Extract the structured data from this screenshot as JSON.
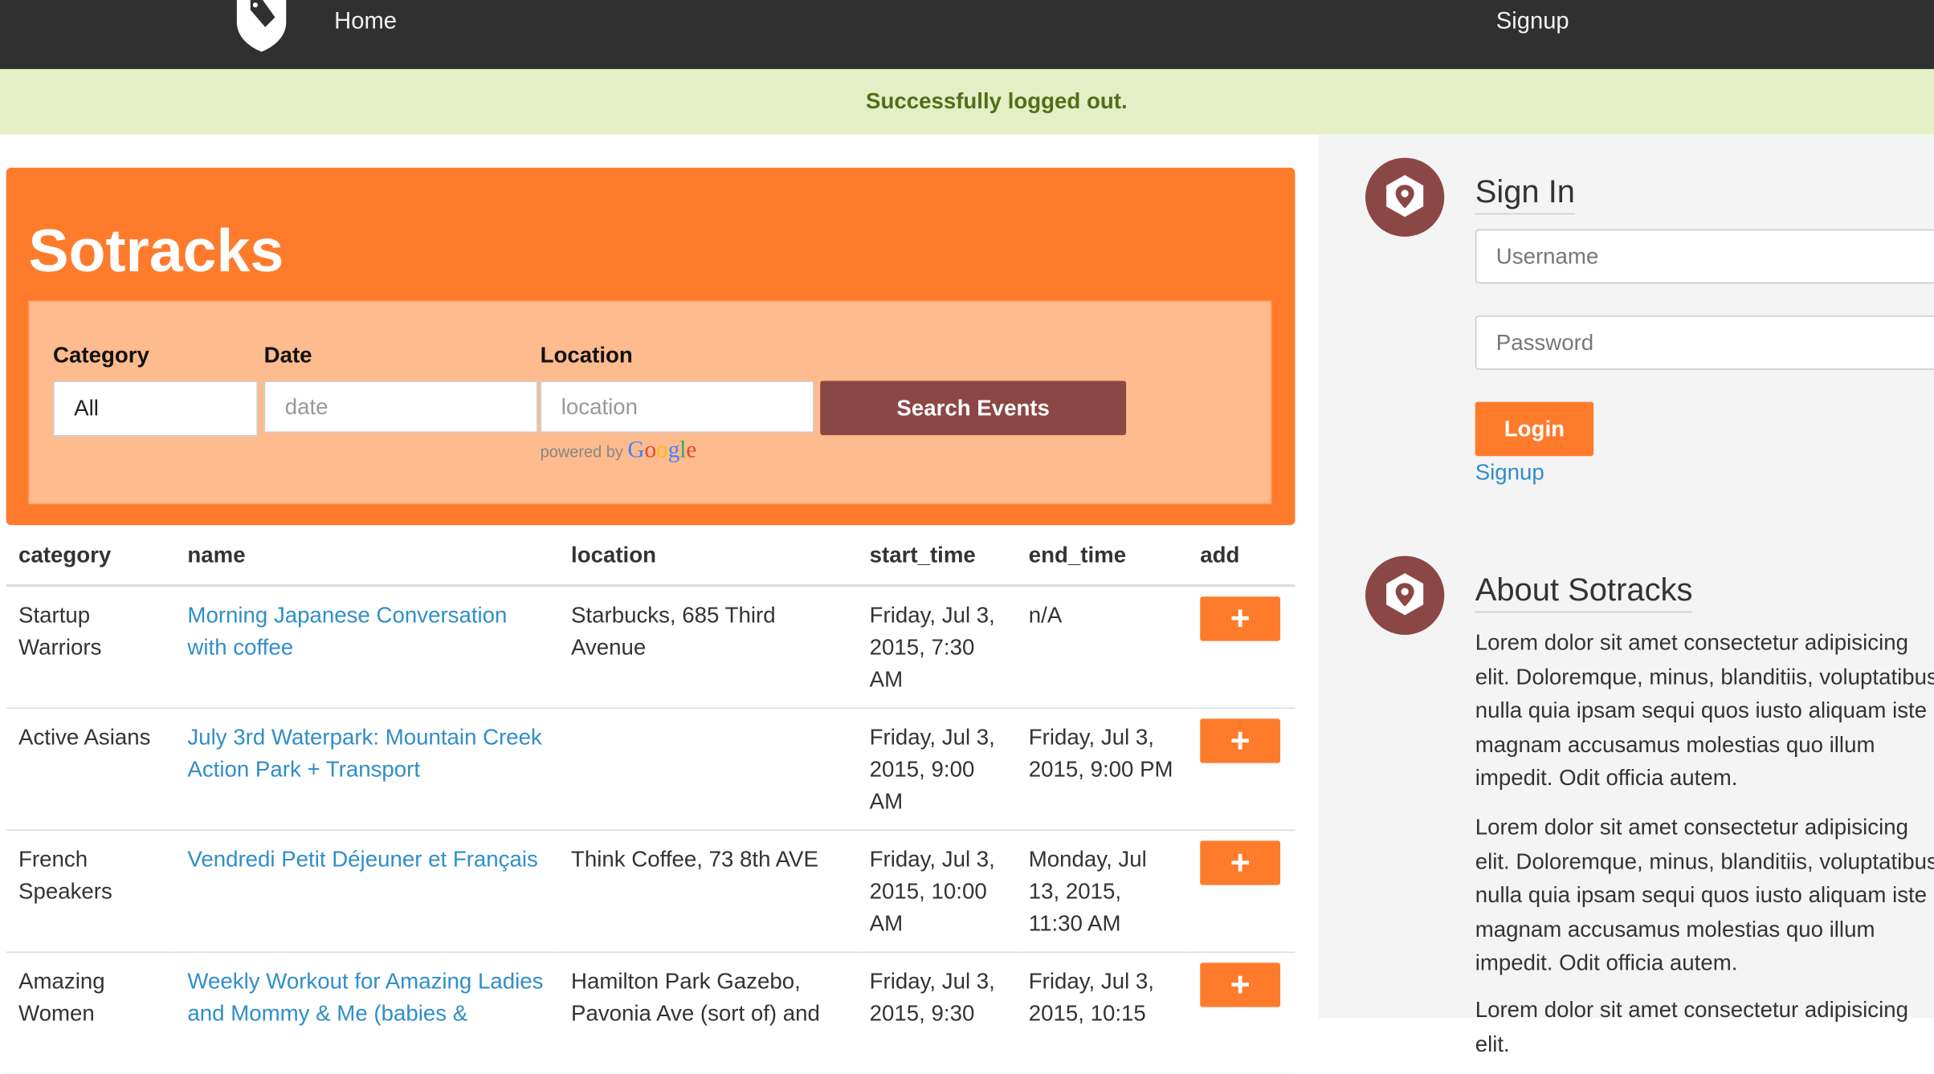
{
  "nav": {
    "home": "Home",
    "signup": "Signup"
  },
  "flash": "Successfully logged out.",
  "hero": {
    "title": "Sotracks"
  },
  "search": {
    "category_label": "Category",
    "category_value": "All",
    "date_label": "Date",
    "date_placeholder": "date",
    "location_label": "Location",
    "location_placeholder": "location",
    "powered_by": "powered by",
    "powered_brand": "Google",
    "button": "Search Events"
  },
  "table": {
    "headers": [
      "category",
      "name",
      "location",
      "start_time",
      "end_time",
      "add"
    ],
    "rows": [
      {
        "category": "Startup Warriors",
        "name": "Morning Japanese Conversation with coffee",
        "location": "Starbucks, 685 Third Avenue",
        "start_time": "Friday, Jul 3, 2015, 7:30 AM",
        "end_time": "n/A",
        "add": "+"
      },
      {
        "category": "Active Asians",
        "name": "July 3rd Waterpark: Mountain Creek Action Park + Transport",
        "location": "",
        "start_time": "Friday, Jul 3, 2015, 9:00 AM",
        "end_time": "Friday, Jul 3, 2015, 9:00 PM",
        "add": "+"
      },
      {
        "category": "French Speakers",
        "name": "Vendredi Petit Déjeuner et Français",
        "location": "Think Coffee, 73 8th AVE",
        "start_time": "Friday, Jul 3, 2015, 10:00 AM",
        "end_time": "Monday, Jul 13, 2015, 11:30 AM",
        "add": "+"
      },
      {
        "category": "Amazing Women",
        "name": "Weekly Workout for Amazing Ladies and Mommy & Me (babies &",
        "location": "Hamilton Park Gazebo, Pavonia Ave (sort of) and",
        "start_time": "Friday, Jul 3, 2015, 9:30",
        "end_time": "Friday, Jul 3, 2015, 10:15",
        "add": "+"
      }
    ]
  },
  "signin": {
    "title": "Sign In",
    "username_placeholder": "Username",
    "password_placeholder": "Password",
    "login": "Login",
    "signup": "Signup"
  },
  "about": {
    "title": "About Sotracks",
    "paragraphs": [
      "Lorem dolor sit amet consectetur adipisicing elit. Doloremque, minus, blanditiis, voluptatibus nulla quia ipsam sequi quos iusto aliquam iste magnam accusamus molestias quo illum impedit. Odit officia autem.",
      "Lorem dolor sit amet consectetur adipisicing elit. Doloremque, minus, blanditiis, voluptatibus nulla quia ipsam sequi quos iusto aliquam iste magnam accusamus molestias quo illum impedit. Odit officia autem.",
      "Lorem dolor sit amet consectetur adipisicing elit."
    ]
  },
  "colors": {
    "accent": "#ff7b2c",
    "brand_dark": "#8b4745",
    "link": "#2f8ec8",
    "navbar": "#303030",
    "flash_bg": "#e5efc6"
  },
  "icons": {
    "logo": "tag-shield-icon",
    "badge": "map-pin-icon",
    "add": "plus-icon"
  }
}
